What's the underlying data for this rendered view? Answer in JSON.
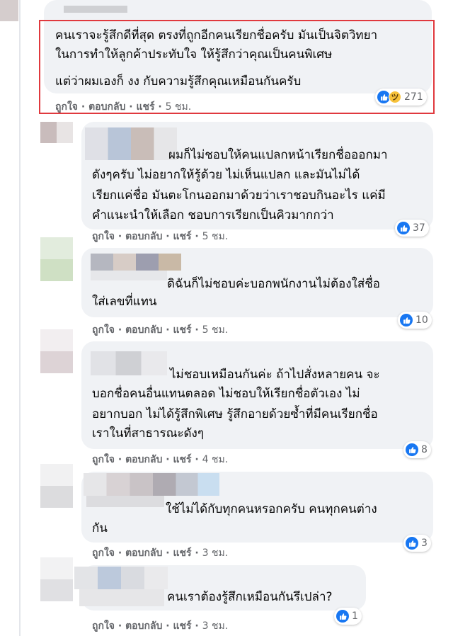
{
  "colors": {
    "highlight": "#e0393e",
    "like": "#1877f2",
    "bubble": "#f0f2f5",
    "meta": "#65676b"
  },
  "comments": [
    {
      "lines": [
        "คนเราจะรู้สึกดีที่สุด ตรงที่ถูกอีกคนเรียกชื่อครับ มันเป็นจิตวิทยา",
        "ในการทำให้ลูกค้าประทับใจ ให้รู้สึกว่าคุณเป็นคนพิเศษ",
        "แต่ว่าผมเองก็ งง กับความรู้สึกคุณเหมือนกันครับ"
      ],
      "like": "ถูกใจ",
      "reply": "ตอบกลับ",
      "share": "แชร์",
      "time": "5 ชม.",
      "reaction_count": "271",
      "reaction_icons": [
        "like-icon",
        "haha-icon"
      ]
    },
    {
      "lines": [
        "ผมก็ไม่ชอบให้คนแปลกหน้าเรียกชื่อออกมา",
        "ดังๆครับ ไม่อยากให้รู้ด้วย ไม่เห็นแปลก และมันไม่ได้",
        "เรียกแค่ชื่อ มันตะโกนออกมาด้วยว่าเราชอบกินอะไร แค่มี",
        "คำแนะนำให้เลือก ชอบการเรียกเป็นคิวมากกว่า"
      ],
      "like": "ถูกใจ",
      "reply": "ตอบกลับ",
      "share": "แชร์",
      "time": "5 ชม.",
      "reaction_count": "37",
      "reaction_icons": [
        "like-icon"
      ]
    },
    {
      "lines": [
        "ดิฉันก็ไม่ชอบค่ะบอกพนักงานไม่ต้องใส่ชื่อ",
        "ใส่เลขที่แทน"
      ],
      "like": "ถูกใจ",
      "reply": "ตอบกลับ",
      "share": "แชร์",
      "time": "5 ชม.",
      "reaction_count": "10",
      "reaction_icons": [
        "like-icon"
      ]
    },
    {
      "lines": [
        "ไม่ชอบเหมือนกันค่ะ ถ้าไปสั่งหลายคน จะ",
        "บอกชื่อคนอื่นแทนตลอด ไม่ชอบให้เรียกชื่อตัวเอง ไม่",
        "อยากบอก ไม่ได้รู้สึกพิเศษ รู้สึกอายด้วยซ้ำที่มีคนเรียกชื่อ",
        "เราในที่สาธารณะดังๆ"
      ],
      "like": "ถูกใจ",
      "reply": "ตอบกลับ",
      "share": "แชร์",
      "time": "4 ชม.",
      "reaction_count": "8",
      "reaction_icons": [
        "like-icon"
      ]
    },
    {
      "lines": [
        "ใช้ไม่ได้กับทุกคนหรอกครับ คนทุกคนต่าง",
        "กัน"
      ],
      "like": "ถูกใจ",
      "reply": "ตอบกลับ",
      "share": "แชร์",
      "time": "3 ชม.",
      "reaction_count": "3",
      "reaction_icons": [
        "like-icon"
      ]
    },
    {
      "lines": [
        "คนเราต้องรู้สึกเหมือนกันรึเปล่า?"
      ],
      "like": "ถูกใจ",
      "reply": "ตอบกลับ",
      "share": "แชร์",
      "time": "3 ชม.",
      "reaction_count": "1",
      "reaction_icons": [
        "like-icon"
      ]
    }
  ]
}
